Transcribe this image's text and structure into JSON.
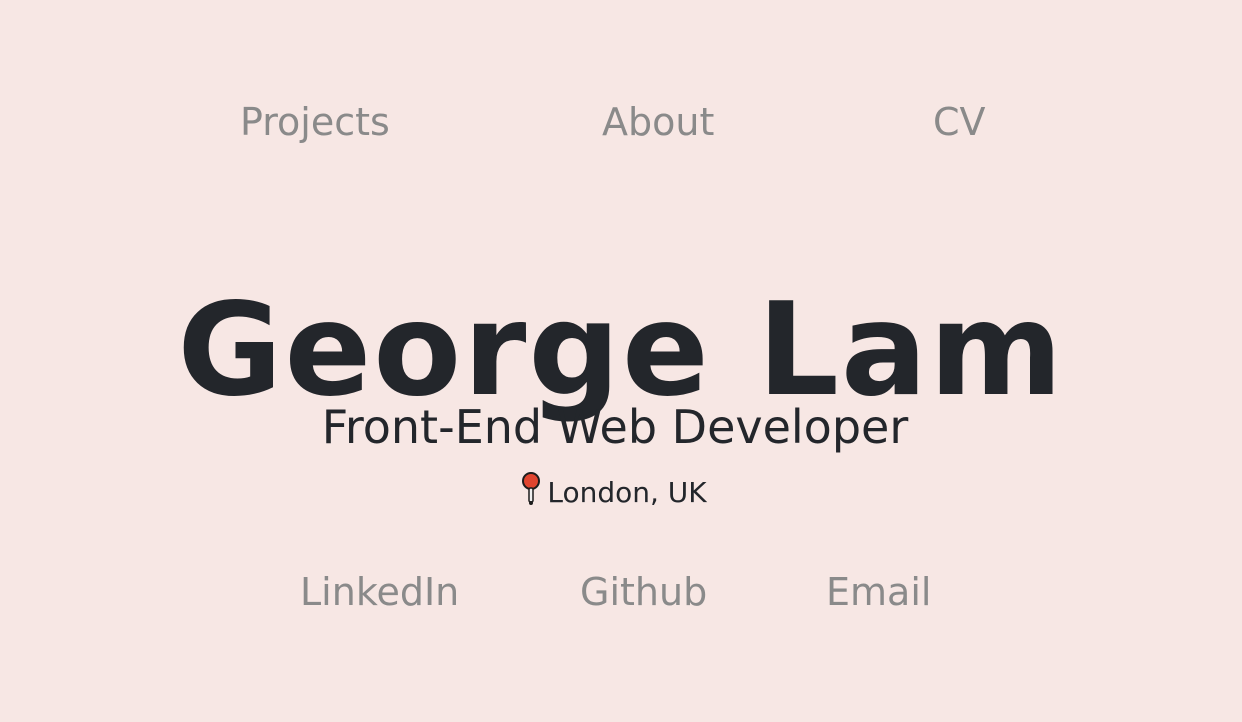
{
  "nav": {
    "projects": "Projects",
    "about": "About",
    "cv": "CV"
  },
  "hero": {
    "name": "George Lam",
    "role": "Front-End Web Developer",
    "location": "London, UK",
    "location_icon": "map-pin-icon"
  },
  "social": {
    "linkedin": "LinkedIn",
    "github": "Github",
    "email": "Email"
  },
  "colors": {
    "background": "#f7e7e4",
    "text_primary": "#23262b",
    "link_muted": "#8a8a8a",
    "pin": "#e0452f"
  }
}
